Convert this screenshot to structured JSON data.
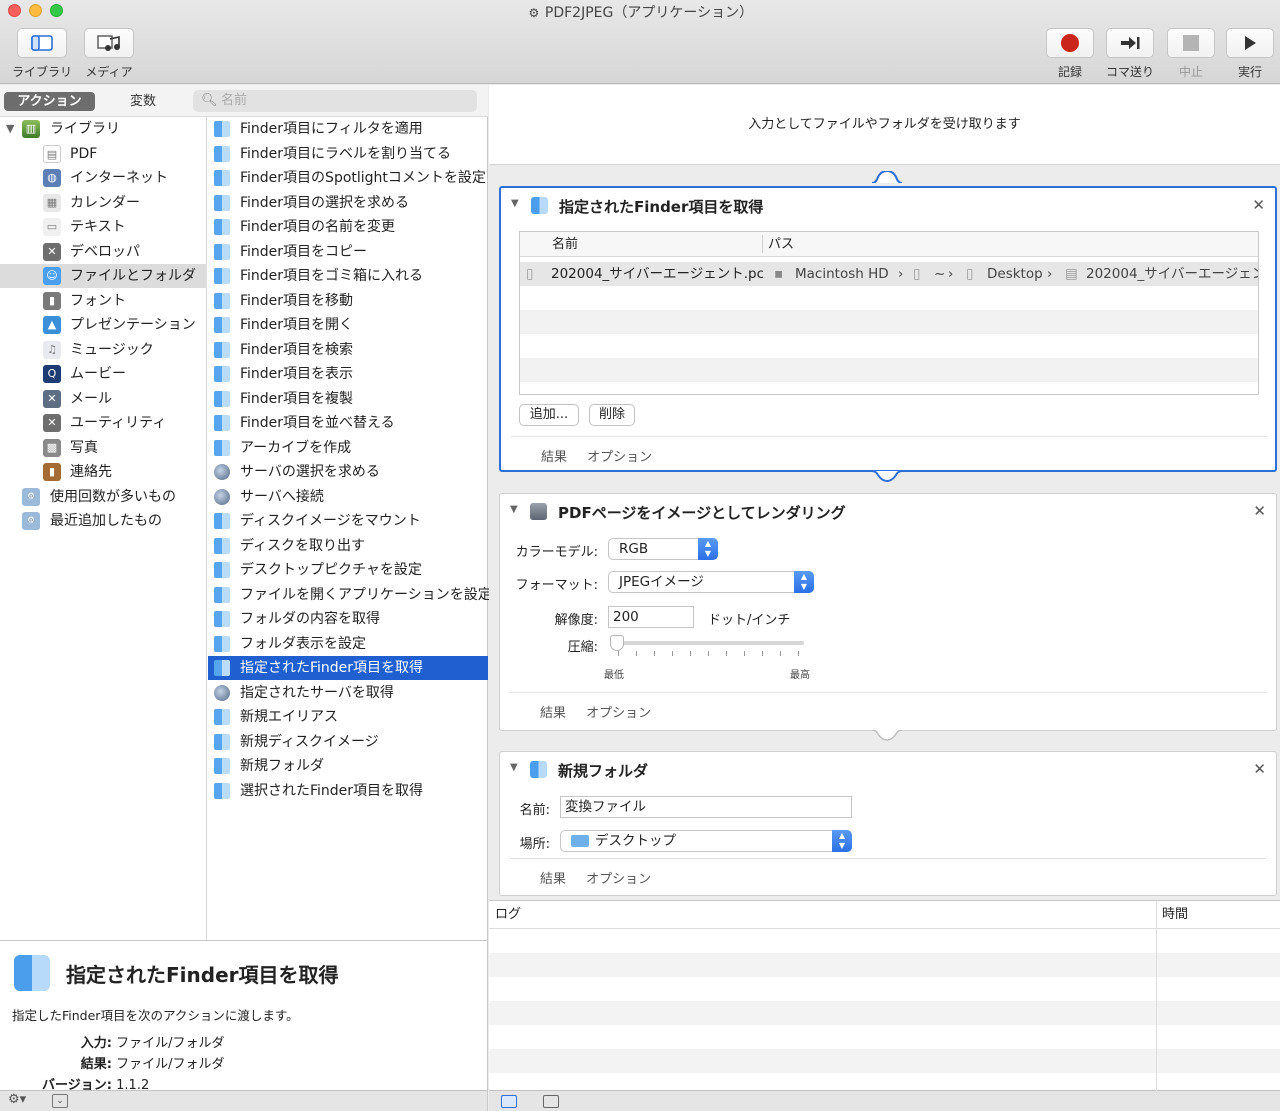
{
  "window": {
    "title": "PDF2JPEG（アプリケーション）",
    "title_icon": "automator-robot-icon"
  },
  "toolbar": {
    "library_label": "ライブラリ",
    "media_label": "メディア",
    "record_label": "記録",
    "step_label": "コマ送り",
    "stop_label": "中止",
    "run_label": "実行"
  },
  "leftpane": {
    "actions_tab": "アクション",
    "variables_tab": "変数",
    "search_placeholder": "名前"
  },
  "library": {
    "root_label": "ライブラリ",
    "items": [
      {
        "label": "PDF",
        "icon": "pdf-icon",
        "color": "#ffffff"
      },
      {
        "label": "インターネット",
        "icon": "globe-icon",
        "color": "#5b7fb6"
      },
      {
        "label": "カレンダー",
        "icon": "calendar-icon",
        "color": "#e8e8e8"
      },
      {
        "label": "テキスト",
        "icon": "text-icon",
        "color": "#f0f0f0"
      },
      {
        "label": "デベロッパ",
        "icon": "tools-icon",
        "color": "#6e6e6e"
      },
      {
        "label": "ファイルとフォルダ",
        "icon": "finder-icon",
        "color": "#4a9eec"
      },
      {
        "label": "フォント",
        "icon": "font-book-icon",
        "color": "#7a7a7a"
      },
      {
        "label": "プレゼンテーション",
        "icon": "keynote-icon",
        "color": "#3b8fd9"
      },
      {
        "label": "ミュージック",
        "icon": "music-icon",
        "color": "#e9e9f0"
      },
      {
        "label": "ムービー",
        "icon": "quicktime-icon",
        "color": "#1c3c73"
      },
      {
        "label": "メール",
        "icon": "mail-icon",
        "color": "#5d6d84"
      },
      {
        "label": "ユーティリティ",
        "icon": "utilities-icon",
        "color": "#6e6e6e"
      },
      {
        "label": "写真",
        "icon": "photos-icon",
        "color": "#8a8a8a"
      },
      {
        "label": "連絡先",
        "icon": "contacts-icon",
        "color": "#a46b33"
      }
    ],
    "smart_groups": [
      {
        "label": "使用回数が多いもの",
        "icon": "smart-folder-icon"
      },
      {
        "label": "最近追加したもの",
        "icon": "smart-folder-icon"
      }
    ]
  },
  "actions": [
    {
      "label": "Finder項目にフィルタを適用",
      "icon": "finder"
    },
    {
      "label": "Finder項目にラベルを割り当てる",
      "icon": "finder"
    },
    {
      "label": "Finder項目のSpotlightコメントを設定",
      "icon": "finder"
    },
    {
      "label": "Finder項目の選択を求める",
      "icon": "finder"
    },
    {
      "label": "Finder項目の名前を変更",
      "icon": "finder"
    },
    {
      "label": "Finder項目をコピー",
      "icon": "finder"
    },
    {
      "label": "Finder項目をゴミ箱に入れる",
      "icon": "finder"
    },
    {
      "label": "Finder項目を移動",
      "icon": "finder"
    },
    {
      "label": "Finder項目を開く",
      "icon": "finder"
    },
    {
      "label": "Finder項目を検索",
      "icon": "finder"
    },
    {
      "label": "Finder項目を表示",
      "icon": "finder"
    },
    {
      "label": "Finder項目を複製",
      "icon": "finder"
    },
    {
      "label": "Finder項目を並べ替える",
      "icon": "finder"
    },
    {
      "label": "アーカイブを作成",
      "icon": "finder"
    },
    {
      "label": "サーバの選択を求める",
      "icon": "globe"
    },
    {
      "label": "サーバへ接続",
      "icon": "globe"
    },
    {
      "label": "ディスクイメージをマウント",
      "icon": "finder"
    },
    {
      "label": "ディスクを取り出す",
      "icon": "finder"
    },
    {
      "label": "デスクトップピクチャを設定",
      "icon": "finder"
    },
    {
      "label": "ファイルを開くアプリケーションを設定",
      "icon": "finder"
    },
    {
      "label": "フォルダの内容を取得",
      "icon": "finder"
    },
    {
      "label": "フォルダ表示を設定",
      "icon": "finder"
    },
    {
      "label": "指定されたFinder項目を取得",
      "icon": "finder"
    },
    {
      "label": "指定されたサーバを取得",
      "icon": "globe"
    },
    {
      "label": "新規エイリアス",
      "icon": "finder"
    },
    {
      "label": "新規ディスクイメージ",
      "icon": "finder"
    },
    {
      "label": "新規フォルダ",
      "icon": "finder"
    },
    {
      "label": "選択されたFinder項目を取得",
      "icon": "finder"
    }
  ],
  "description": {
    "title": "指定されたFinder項目を取得",
    "text": "指定したFinder項目を次のアクションに渡します。",
    "input_key": "入力:",
    "input_val": "ファイル/フォルダ",
    "result_key": "結果:",
    "result_val": "ファイル/フォルダ",
    "version_key": "バージョン:",
    "version_val": "1.1.2"
  },
  "workflow": {
    "input_header": "入力としてファイルやフォルダを受け取ります",
    "action1": {
      "title": "指定されたFinder項目を取得",
      "col_name": "名前",
      "col_path": "パス",
      "file_name": "202004_サイバーエージェント.pc",
      "path_disk": "Macintosh HD",
      "path_sep": "›",
      "path_home": "~",
      "path_desktop": "Desktop",
      "path_file": "202004_サイバーエージェン",
      "add_button": "追加...",
      "delete_button": "削除",
      "results": "結果",
      "options": "オプション"
    },
    "action2": {
      "title": "PDFページをイメージとしてレンダリング",
      "color_model_label": "カラーモデル:",
      "color_model_value": "RGB",
      "format_label": "フォーマット:",
      "format_value": "JPEGイメージ",
      "resolution_label": "解像度:",
      "resolution_value": "200",
      "resolution_unit": "ドット/インチ",
      "compression_label": "圧縮:",
      "compression_min": "最低",
      "compression_max": "最高",
      "compression_level": 0,
      "results": "結果",
      "options": "オプション"
    },
    "action3": {
      "title": "新規フォルダ",
      "name_label": "名前:",
      "name_value": "変換ファイル",
      "location_label": "場所:",
      "location_value": "デスクトップ",
      "results": "結果",
      "options": "オプション"
    }
  },
  "log": {
    "col_log": "ログ",
    "col_time": "時間"
  },
  "colors": {
    "selection_blue": "#1f5fcf",
    "selected_action_border": "#2d6fd6",
    "record_red": "#c9251b"
  }
}
